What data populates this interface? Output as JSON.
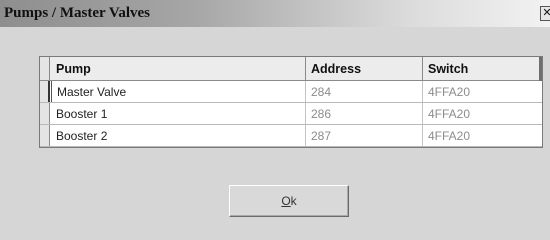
{
  "window": {
    "title": "Pumps / Master Valves",
    "close_glyph": "✕"
  },
  "grid": {
    "columns": [
      "Pump",
      "Address",
      "Switch"
    ],
    "rows": [
      {
        "pump": "Master Valve",
        "address": "284",
        "switch": "4FFA20"
      },
      {
        "pump": "Booster 1",
        "address": "286",
        "switch": "4FFA20"
      },
      {
        "pump": "Booster 2",
        "address": "287",
        "switch": "4FFA20"
      }
    ]
  },
  "buttons": {
    "ok_mnemonic": "O",
    "ok_rest": "k"
  }
}
